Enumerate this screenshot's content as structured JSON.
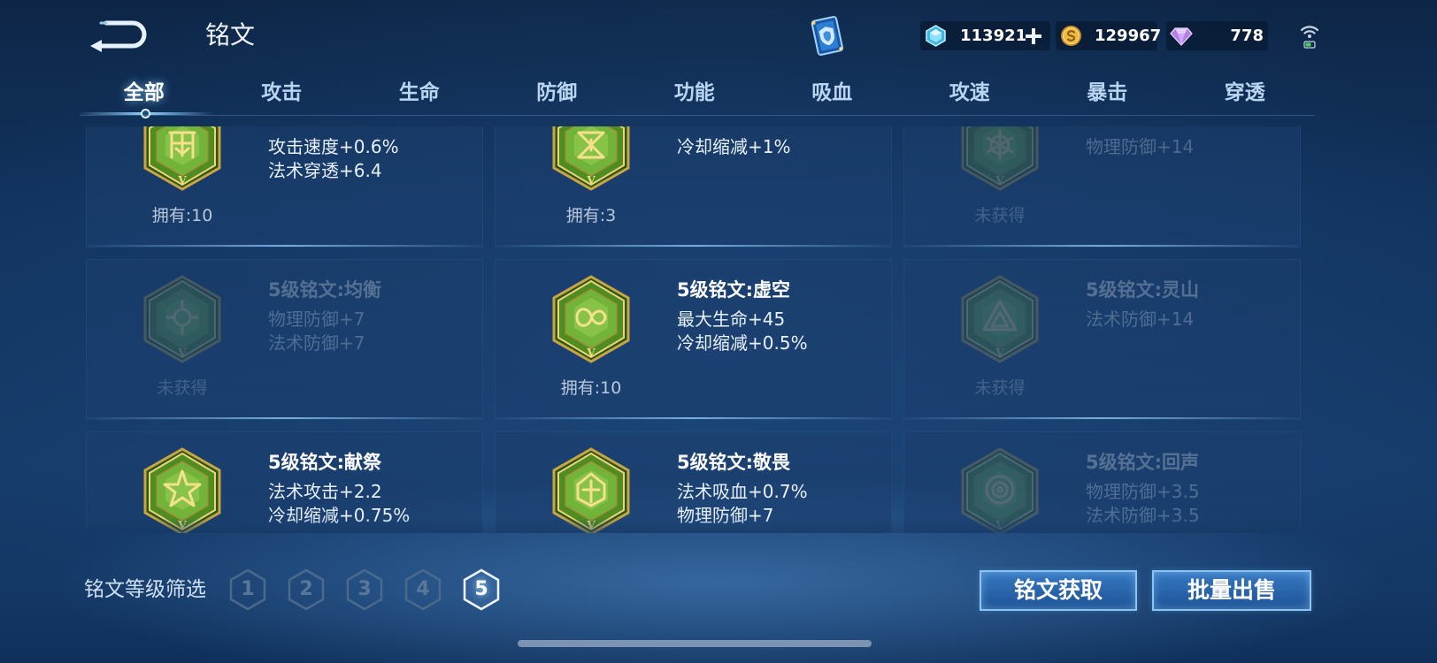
{
  "header": {
    "title": "铭文",
    "back_icon": "back-arrow-icon",
    "book_icon": "inscription-book-icon",
    "network_icon": "wifi-signal-icon"
  },
  "currencies": [
    {
      "id": "diamond",
      "icon": "diamond-icon",
      "value": "113921",
      "add_icon": "plus-icon"
    },
    {
      "id": "gold",
      "icon": "gold-coin-icon",
      "value": "129967"
    },
    {
      "id": "gem",
      "icon": "purple-gem-icon",
      "value": "778"
    }
  ],
  "tabs": [
    {
      "label": "全部",
      "selected": true
    },
    {
      "label": "攻击"
    },
    {
      "label": "生命"
    },
    {
      "label": "防御"
    },
    {
      "label": "功能"
    },
    {
      "label": "吸血"
    },
    {
      "label": "攻速"
    },
    {
      "label": "暴击"
    },
    {
      "label": "穿透"
    }
  ],
  "inscription_level_mark": "V",
  "inscriptions": [
    {
      "emblem": "gate",
      "stats": [
        "攻击速度+0.6%",
        "法术穿透+6.4"
      ],
      "owned": "拥有:10",
      "obtained": true
    },
    {
      "emblem": "hourglass",
      "stats": [
        "冷却缩减+1%"
      ],
      "owned": "拥有:3",
      "obtained": true
    },
    {
      "emblem": "web",
      "stats": [
        "物理防御+14"
      ],
      "owned": "未获得",
      "obtained": false
    },
    {
      "emblem": "balance",
      "title": "5级铭文:均衡",
      "stats": [
        "物理防御+7",
        "法术防御+7"
      ],
      "owned": "未获得",
      "obtained": false
    },
    {
      "emblem": "void",
      "title": "5级铭文:虚空",
      "stats": [
        "最大生命+45",
        "冷却缩减+0.5%"
      ],
      "owned": "拥有:10",
      "obtained": true
    },
    {
      "emblem": "mountain",
      "title": "5级铭文:灵山",
      "stats": [
        "法术防御+14"
      ],
      "owned": "未获得",
      "obtained": false
    },
    {
      "emblem": "sacrifice",
      "title": "5级铭文:献祭",
      "stats": [
        "法术攻击+2.2",
        "冷却缩减+0.75%"
      ],
      "obtained": true
    },
    {
      "emblem": "awe",
      "title": "5级铭文:敬畏",
      "stats": [
        "法术吸血+0.7%",
        "物理防御+7"
      ],
      "obtained": true
    },
    {
      "emblem": "echo",
      "title": "5级铭文:回声",
      "stats": [
        "物理防御+3.5",
        "法术防御+3.5"
      ],
      "obtained": false
    }
  ],
  "filter": {
    "label": "铭文等级筛选",
    "levels": [
      "1",
      "2",
      "3",
      "4",
      "5"
    ],
    "selected": "5"
  },
  "actions": {
    "obtain_label": "铭文获取",
    "bulk_sell_label": "批量出售"
  },
  "colors": {
    "accent": "#8fd3ff",
    "emblem_green": "#4f8d22",
    "emblem_gold": "#f0d27a",
    "level_inactive": "#4a6a8c"
  }
}
